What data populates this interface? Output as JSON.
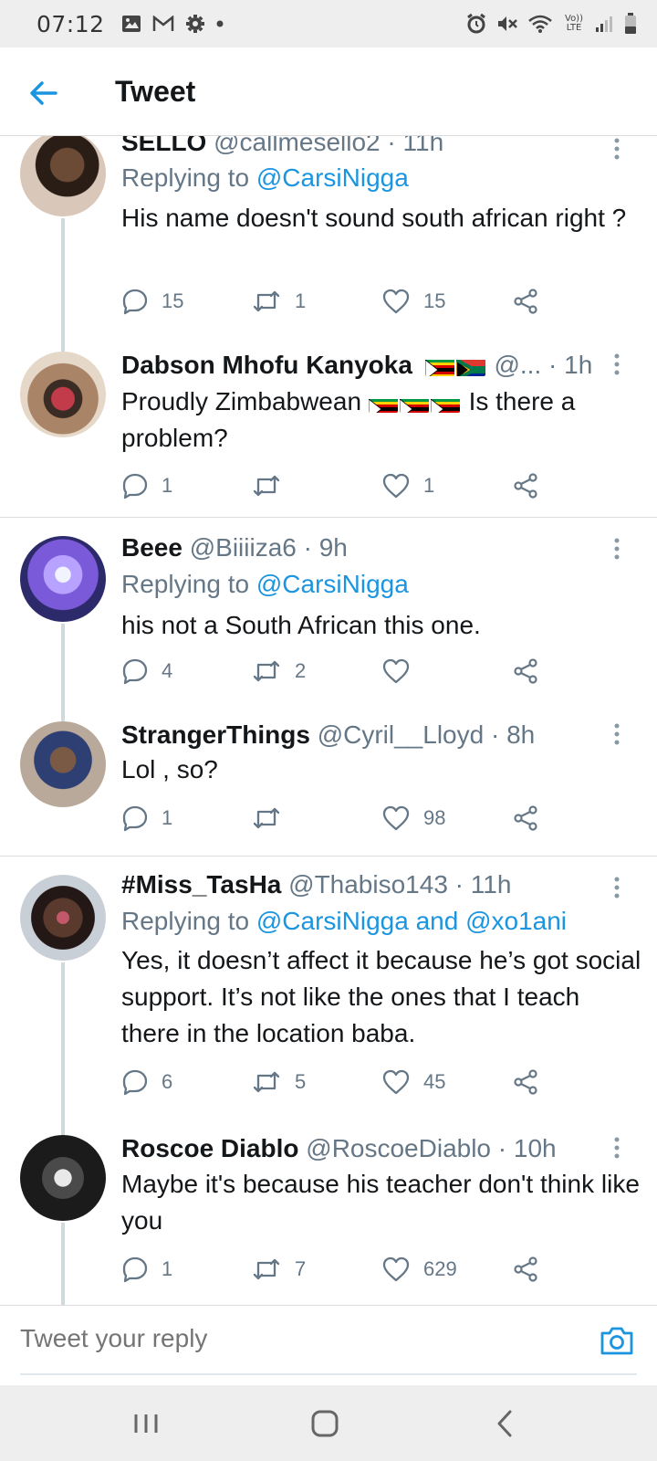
{
  "status_bar": {
    "time": "07:12",
    "left_icons": [
      "gallery-icon",
      "gmail-icon",
      "settings-gear-icon",
      "dot-icon"
    ],
    "right_icons": [
      "alarm-icon",
      "mute-icon",
      "wifi-icon",
      "volte-lte-icon",
      "signal-icon",
      "battery-icon"
    ],
    "lte_label": "Vo)) LTE"
  },
  "header": {
    "back_icon": "arrow-left-icon",
    "title": "Tweet"
  },
  "colors": {
    "accent": "#1b95e0",
    "text": "#14171a",
    "secondary_text": "#657786",
    "divider": "#dcdcdc"
  },
  "tweets": [
    {
      "name": "SELLO",
      "handle_time": " @callmesello2 · 11h",
      "replying_prefix": "Replying to ",
      "replying_to": "@CarsiNigga",
      "text": "His name doesn't sound south african right ?",
      "replies": "15",
      "retweets": "1",
      "likes": "15"
    },
    {
      "name": "Dabson Mhofu Kanyoka",
      "handle_time": " @... · 1h",
      "text_before": "Proudly Zimbabwean ",
      "text_after": " Is there a problem?",
      "replies": "1",
      "retweets": "",
      "likes": "1"
    },
    {
      "name": "Beee",
      "handle_time": " @Biiiiza6 · 9h",
      "replying_prefix": "Replying to ",
      "replying_to": "@CarsiNigga",
      "text": "his not a South African this one.",
      "replies": "4",
      "retweets": "2",
      "likes": ""
    },
    {
      "name": "StrangerThings",
      "handle_time": " @Cyril__Lloyd · 8h",
      "text": "Lol , so?",
      "replies": "1",
      "retweets": "",
      "likes": "98"
    },
    {
      "name": "#Miss_TasHa",
      "handle_time": " @Thabiso143 · 11h",
      "replying_prefix": "Replying to ",
      "replying_to": "@CarsiNigga and @xo1ani",
      "text": "Yes, it doesn’t affect it because he’s got social support. It’s not like the ones that I teach there in the location baba.",
      "replies": "6",
      "retweets": "5",
      "likes": "45"
    },
    {
      "name": "Roscoe Diablo",
      "handle_time": " @RoscoeDiablo · 10h",
      "text": "Maybe it's because his teacher don't think like you",
      "replies": "1",
      "retweets": "7",
      "likes": "629"
    }
  ],
  "composer": {
    "placeholder": "Tweet your reply",
    "camera_icon": "camera-icon"
  },
  "nav_bar": {
    "icons": [
      "recent-apps-icon",
      "home-icon",
      "back-icon"
    ]
  }
}
